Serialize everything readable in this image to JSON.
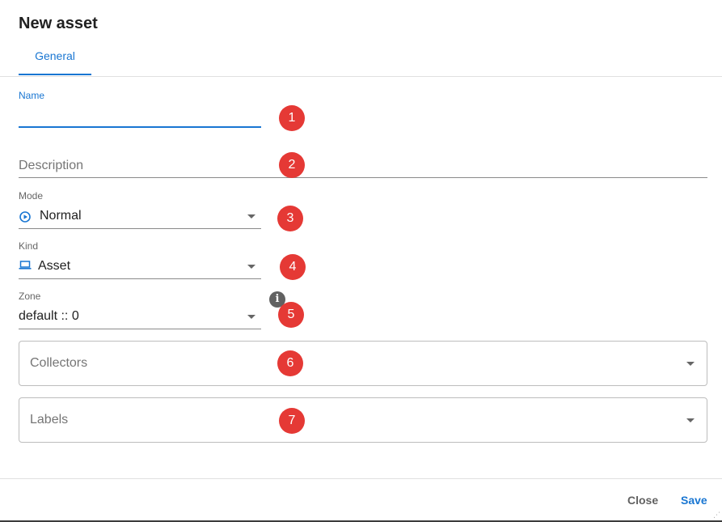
{
  "dialog": {
    "title": "New asset",
    "tabs": [
      {
        "label": "General",
        "active": true
      }
    ]
  },
  "form": {
    "name": {
      "label": "Name",
      "value": "",
      "focused": true
    },
    "description": {
      "placeholder": "Description"
    },
    "mode": {
      "label": "Mode",
      "value": "Normal",
      "icon": "play-circle-icon"
    },
    "kind": {
      "label": "Kind",
      "value": "Asset",
      "icon": "laptop-icon"
    },
    "zone": {
      "label": "Zone",
      "value": "default :: 0",
      "info_icon": "info-icon"
    },
    "collectors": {
      "placeholder": "Collectors"
    },
    "labels": {
      "placeholder": "Labels"
    }
  },
  "annotations": [
    "1",
    "2",
    "3",
    "4",
    "5",
    "6",
    "7"
  ],
  "footer": {
    "close_label": "Close",
    "save_label": "Save"
  },
  "colors": {
    "accent": "#1976d2",
    "annotation_badge": "#e53935"
  }
}
